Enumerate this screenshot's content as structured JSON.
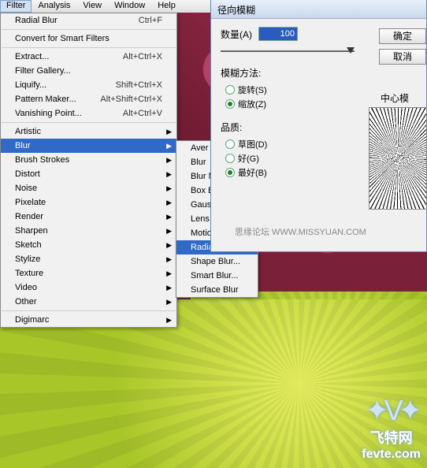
{
  "menubar": {
    "items": [
      "Filter",
      "Analysis",
      "View",
      "Window",
      "Help"
    ],
    "active_index": 0
  },
  "filter_menu": {
    "last_used": {
      "label": "Radial Blur",
      "shortcut": "Ctrl+F"
    },
    "convert": "Convert for Smart Filters",
    "group1": [
      {
        "label": "Extract...",
        "shortcut": "Alt+Ctrl+X"
      },
      {
        "label": "Filter Gallery...",
        "shortcut": ""
      },
      {
        "label": "Liquify...",
        "shortcut": "Shift+Ctrl+X"
      },
      {
        "label": "Pattern Maker...",
        "shortcut": "Alt+Shift+Ctrl+X"
      },
      {
        "label": "Vanishing Point...",
        "shortcut": "Alt+Ctrl+V"
      }
    ],
    "categories": [
      "Artistic",
      "Blur",
      "Brush Strokes",
      "Distort",
      "Noise",
      "Pixelate",
      "Render",
      "Sharpen",
      "Sketch",
      "Stylize",
      "Texture",
      "Video",
      "Other"
    ],
    "digimarc": "Digimarc",
    "highlight_index": 1
  },
  "blur_submenu": {
    "items": [
      "Aver",
      "Blur",
      "Blur M",
      "Box B",
      "Gaus",
      "Lens Blur...",
      "Motion Blur...",
      "Radial Blur...",
      "Shape Blur...",
      "Smart Blur...",
      "Surface Blur"
    ],
    "highlight_index": 7
  },
  "dialog": {
    "title": "径向模糊",
    "amount_label": "数量(A)",
    "amount_value": "100",
    "ok": "确定",
    "cancel": "取消",
    "method_label": "模糊方法:",
    "method_options": [
      {
        "label": "旋转(S)",
        "checked": false
      },
      {
        "label": "缩放(Z)",
        "checked": true
      }
    ],
    "quality_label": "品质:",
    "quality_options": [
      {
        "label": "草图(D)",
        "checked": false
      },
      {
        "label": "好(G)",
        "checked": false
      },
      {
        "label": "最好(B)",
        "checked": true
      }
    ],
    "center_label": "中心模",
    "watermark": "思缘论坛  WWW.MISSYUAN.COM"
  },
  "logo": {
    "name": "飞特网",
    "url": "fevte.com"
  }
}
